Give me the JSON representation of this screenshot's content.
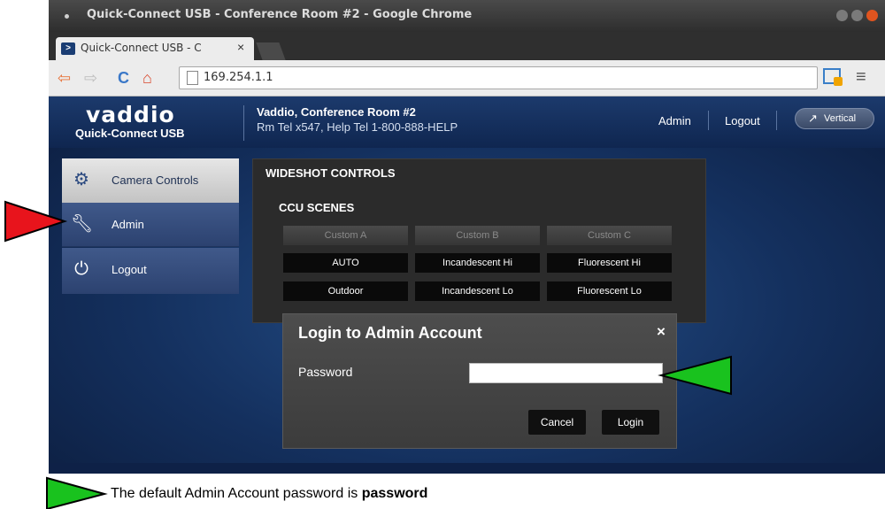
{
  "browser": {
    "window_title": "Quick-Connect USB - Conference Room #2 - Google Chrome",
    "tab_title": "Quick-Connect USB - C",
    "url": "169.254.1.1",
    "colors": {
      "back_arrow": "#e8733a",
      "reload": "#3a78c8",
      "home": "#d9472b"
    }
  },
  "header": {
    "logo": "vaddio",
    "product": "Quick-Connect USB",
    "room_name": "Vaddio, Conference Room #2",
    "room_phone": "Rm Tel x547, Help Tel 1-800-888-HELP",
    "admin_link": "Admin",
    "logout_link": "Logout",
    "vertical_button": "Vertical"
  },
  "sidebar": {
    "items": [
      {
        "label": "Camera Controls",
        "icon": "camera-controls-icon"
      },
      {
        "label": "Admin",
        "icon": "wrench-icon"
      },
      {
        "label": "Logout",
        "icon": "power-icon"
      }
    ]
  },
  "panel": {
    "title": "WIDESHOT CONTROLS",
    "section_title": "CCU SCENES",
    "custom_buttons": [
      "Custom A",
      "Custom B",
      "Custom C"
    ],
    "preset_rows": [
      [
        "AUTO",
        "Incandescent Hi",
        "Fluorescent Hi"
      ],
      [
        "Outdoor",
        "Incandescent Lo",
        "Fluorescent Lo"
      ]
    ]
  },
  "modal": {
    "title": "Login to Admin Account",
    "close": "×",
    "password_label": "Password",
    "password_value": "",
    "cancel": "Cancel",
    "login": "Login"
  },
  "annotation": {
    "caption_prefix": "The default Admin Account password is ",
    "caption_bold": "password",
    "colors": {
      "red_arrow": "#e8141c",
      "green_arrow": "#19c21e"
    }
  }
}
